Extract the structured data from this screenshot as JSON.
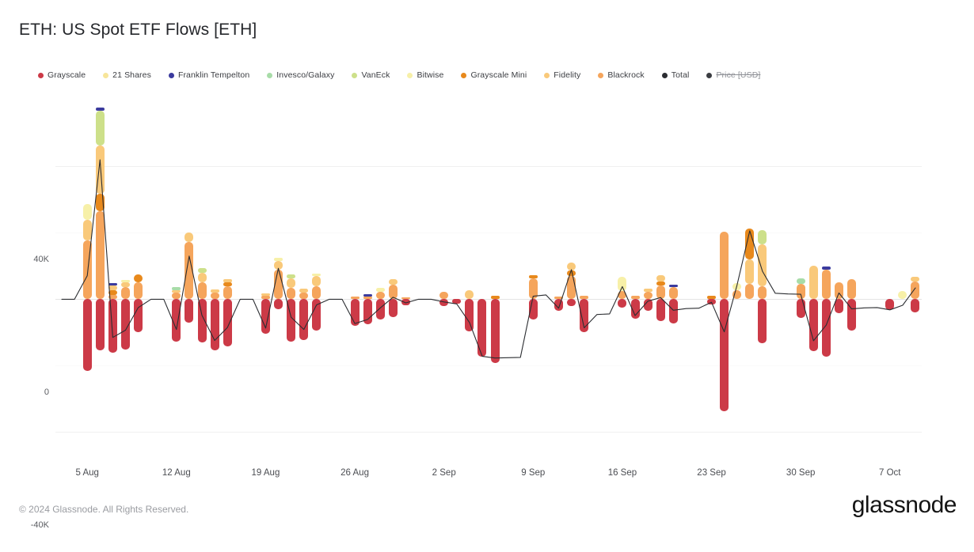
{
  "header": {
    "title": "ETH: US Spot ETF Flows [ETH]"
  },
  "footer": {
    "copyright": "© 2024 Glassnode. All Rights Reserved.",
    "brand": "glassnode"
  },
  "legend": {
    "items": [
      {
        "label": "Grayscale",
        "color": "#CC3A४7",
        "enabled": true
      },
      {
        "label": "21 Shares",
        "color": "#F7E59A",
        "enabled": true
      },
      {
        "label": "Franklin Tempelton",
        "color": "#3B3B9E",
        "enabled": true
      },
      {
        "label": "Invesco/Galaxy",
        "color": "#A8DCA8",
        "enabled": true
      },
      {
        "label": "VanEck",
        "color": "#CDE08A",
        "enabled": true
      },
      {
        "label": "Bitwise",
        "color": "#F7F0A8",
        "enabled": true
      },
      {
        "label": "Grayscale Mini",
        "color": "#E8891C",
        "enabled": true
      },
      {
        "label": "Fidelity",
        "color": "#F9C97A",
        "enabled": true
      },
      {
        "label": "Blackrock",
        "color": "#F5A55C",
        "enabled": true
      },
      {
        "label": "Total",
        "color": "#2B2D31",
        "enabled": true
      },
      {
        "label": "Price [USD]",
        "color": "#3B3D42",
        "enabled": false
      }
    ]
  },
  "chart_data": {
    "type": "bar",
    "title": "ETH: US Spot ETF Flows [ETH]",
    "subtype": "stacked-bar-with-line",
    "xlabel": "",
    "ylabel": "",
    "ylim": [
      -48000,
      62000
    ],
    "yticks": [
      40000,
      0,
      -40000
    ],
    "ytick_labels": [
      "40K",
      "0",
      "-40K"
    ],
    "xtick_labels": [
      "5 Aug",
      "12 Aug",
      "19 Aug",
      "26 Aug",
      "2 Sep",
      "9 Sep",
      "16 Sep",
      "23 Sep",
      "30 Sep",
      "7 Oct"
    ],
    "xtick_indices": [
      2,
      9,
      16,
      23,
      30,
      37,
      44,
      51,
      58,
      65
    ],
    "grid": true,
    "legend_position": "top-left",
    "series_order": [
      "Grayscale",
      "Blackrock",
      "Grayscale Mini",
      "Fidelity",
      "Bitwise",
      "21 Shares",
      "VanEck",
      "Invesco/Galaxy",
      "Franklin Tempelton"
    ],
    "series_colors": {
      "Grayscale": "#CC3A47",
      "Blackrock": "#F5A55C",
      "Grayscale Mini": "#E8891C",
      "Fidelity": "#F9C97A",
      "Bitwise": "#F7F0A8",
      "21 Shares": "#F7E59A",
      "VanEck": "#CDE08A",
      "Invesco/Galaxy": "#A8DCA8",
      "Franklin Tempelton": "#3B3B9E",
      "Total": "#2B2D31"
    },
    "note": "Each point: d=date label, pos=[[series,value]...] stacked upward from 0, neg=[[series,value]...] stacked downward from 0, total=black Total line value.",
    "points": [
      {
        "d": "3 Aug",
        "pos": [],
        "neg": [],
        "total": 0
      },
      {
        "d": "4 Aug",
        "pos": [],
        "neg": [],
        "total": 0
      },
      {
        "d": "5 Aug",
        "pos": [
          [
            "Blackrock",
            17800
          ],
          [
            "Fidelity",
            6200
          ],
          [
            "Bitwise",
            4600
          ]
        ],
        "neg": [
          [
            "Grayscale",
            -21500
          ]
        ],
        "total": 7100
      },
      {
        "d": "6 Aug",
        "pos": [
          [
            "Blackrock",
            26500
          ],
          [
            "Grayscale Mini",
            5200
          ],
          [
            "Fidelity",
            14500
          ],
          [
            "VanEck",
            10500
          ],
          [
            "Franklin Tempelton",
            900
          ]
        ],
        "neg": [
          [
            "Grayscale",
            -15500
          ]
        ],
        "total": 42000
      },
      {
        "d": "7 Aug",
        "pos": [
          [
            "Blackrock",
            1400
          ],
          [
            "Grayscale Mini",
            1300
          ],
          [
            "Fidelity",
            1500
          ],
          [
            "Franklin Tempelton",
            700
          ]
        ],
        "neg": [
          [
            "Grayscale",
            -16200
          ]
        ],
        "total": -11500
      },
      {
        "d": "8 Aug",
        "pos": [
          [
            "Blackrock",
            3600
          ],
          [
            "Fidelity",
            1400
          ],
          [
            "Bitwise",
            900
          ]
        ],
        "neg": [
          [
            "Grayscale",
            -15200
          ]
        ],
        "total": -9300
      },
      {
        "d": "9 Aug",
        "pos": [
          [
            "Blackrock",
            5000
          ],
          [
            "Grayscale Mini",
            2400
          ]
        ],
        "neg": [
          [
            "Grayscale",
            -9800
          ]
        ],
        "total": -2500
      },
      {
        "d": "10 Aug",
        "pos": [],
        "neg": [],
        "total": 0
      },
      {
        "d": "11 Aug",
        "pos": [],
        "neg": [],
        "total": 0
      },
      {
        "d": "12 Aug",
        "pos": [
          [
            "Blackrock",
            1900
          ],
          [
            "Fidelity",
            900
          ],
          [
            "Invesco/Galaxy",
            800
          ]
        ],
        "neg": [
          [
            "Grayscale",
            -12700
          ]
        ],
        "total": -9100
      },
      {
        "d": "13 Aug",
        "pos": [
          [
            "Blackrock",
            17200
          ],
          [
            "Fidelity",
            2900
          ]
        ],
        "neg": [
          [
            "Grayscale",
            -7100
          ]
        ],
        "total": 13000
      },
      {
        "d": "14 Aug",
        "pos": [
          [
            "Blackrock",
            5200
          ],
          [
            "Fidelity",
            2800
          ],
          [
            "VanEck",
            1400
          ]
        ],
        "neg": [
          [
            "Grayscale",
            -12900
          ]
        ],
        "total": -4800
      },
      {
        "d": "15 Aug",
        "pos": [
          [
            "Blackrock",
            2100
          ],
          [
            "Fidelity",
            900
          ]
        ],
        "neg": [
          [
            "Grayscale",
            -15300
          ]
        ],
        "total": -12400
      },
      {
        "d": "16 Aug",
        "pos": [
          [
            "Blackrock",
            3800
          ],
          [
            "Grayscale Mini",
            1300
          ],
          [
            "Fidelity",
            900
          ]
        ],
        "neg": [
          [
            "Grayscale",
            -14300
          ]
        ],
        "total": -8500
      },
      {
        "d": "17 Aug",
        "pos": [],
        "neg": [],
        "total": 0
      },
      {
        "d": "18 Aug",
        "pos": [],
        "neg": [],
        "total": 0
      },
      {
        "d": "19 Aug",
        "pos": [
          [
            "Blackrock",
            1100
          ],
          [
            "Fidelity",
            700
          ]
        ],
        "neg": [
          [
            "Grayscale",
            -10500
          ]
        ],
        "total": -8700
      },
      {
        "d": "20 Aug",
        "pos": [
          [
            "Blackrock",
            8900
          ],
          [
            "Fidelity",
            2600
          ],
          [
            "Bitwise",
            900
          ]
        ],
        "neg": [
          [
            "Grayscale",
            -3100
          ]
        ],
        "total": 9300
      },
      {
        "d": "21 Aug",
        "pos": [
          [
            "Blackrock",
            3400
          ],
          [
            "Fidelity",
            2900
          ],
          [
            "VanEck",
            1100
          ]
        ],
        "neg": [
          [
            "Grayscale",
            -12800
          ]
        ],
        "total": -5400
      },
      {
        "d": "22 Aug",
        "pos": [
          [
            "Blackrock",
            1900
          ],
          [
            "Fidelity",
            1200
          ]
        ],
        "neg": [
          [
            "Grayscale",
            -12200
          ]
        ],
        "total": -9100
      },
      {
        "d": "23 Aug",
        "pos": [
          [
            "Blackrock",
            3900
          ],
          [
            "Fidelity",
            3100
          ],
          [
            "Bitwise",
            700
          ]
        ],
        "neg": [
          [
            "Grayscale",
            -9400
          ]
        ],
        "total": -1700
      },
      {
        "d": "24 Aug",
        "pos": [],
        "neg": [],
        "total": 0
      },
      {
        "d": "25 Aug",
        "pos": [],
        "neg": [],
        "total": 0
      },
      {
        "d": "26 Aug",
        "pos": [
          [
            "Blackrock",
            800
          ]
        ],
        "neg": [
          [
            "Grayscale",
            -8100
          ]
        ],
        "total": -7300
      },
      {
        "d": "27 Aug",
        "pos": [
          [
            "Blackrock",
            900
          ],
          [
            "Franklin Tempelton",
            600
          ]
        ],
        "neg": [
          [
            "Grayscale",
            -7600
          ]
        ],
        "total": -6100
      },
      {
        "d": "28 Aug",
        "pos": [
          [
            "Blackrock",
            2200
          ],
          [
            "Bitwise",
            1300
          ]
        ],
        "neg": [
          [
            "Grayscale",
            -6100
          ]
        ],
        "total": -2600
      },
      {
        "d": "29 Aug",
        "pos": [
          [
            "Blackrock",
            4400
          ],
          [
            "Fidelity",
            1600
          ]
        ],
        "neg": [
          [
            "Grayscale",
            -5400
          ]
        ],
        "total": 600
      },
      {
        "d": "30 Aug",
        "pos": [
          [
            "Blackrock",
            600
          ]
        ],
        "neg": [
          [
            "Grayscale",
            -1700
          ]
        ],
        "total": -1100
      },
      {
        "d": "31 Aug",
        "pos": [],
        "neg": [],
        "total": 0
      },
      {
        "d": "1 Sep",
        "pos": [],
        "neg": [],
        "total": 0
      },
      {
        "d": "2 Sep",
        "pos": [
          [
            "Blackrock",
            2300
          ]
        ],
        "neg": [
          [
            "Grayscale",
            -2100
          ]
        ],
        "total": -800
      },
      {
        "d": "3 Sep",
        "pos": [],
        "neg": [
          [
            "Grayscale",
            -1400
          ]
        ],
        "total": -1400
      },
      {
        "d": "4 Sep",
        "pos": [
          [
            "Fidelity",
            2600
          ]
        ],
        "neg": [
          [
            "Grayscale",
            -9600
          ]
        ],
        "total": -7000
      },
      {
        "d": "5 Sep",
        "pos": [],
        "neg": [
          [
            "Grayscale",
            -17200
          ]
        ],
        "total": -17200
      },
      {
        "d": "6 Sep",
        "pos": [
          [
            "Grayscale Mini",
            1100
          ]
        ],
        "neg": [
          [
            "Grayscale",
            -19200
          ]
        ],
        "total": -17700
      },
      {
        "d": "7 Sep",
        "pos": [],
        "neg": [],
        "total": -17600
      },
      {
        "d": "8 Sep",
        "pos": [],
        "neg": [],
        "total": -17500
      },
      {
        "d": "9 Sep",
        "pos": [
          [
            "Blackrock",
            6400
          ],
          [
            "Grayscale Mini",
            900
          ]
        ],
        "neg": [
          [
            "Grayscale",
            -6100
          ]
        ],
        "total": 900
      },
      {
        "d": "10 Sep",
        "pos": [],
        "neg": [],
        "total": 1300
      },
      {
        "d": "11 Sep",
        "pos": [
          [
            "Blackrock",
            700
          ]
        ],
        "neg": [
          [
            "Grayscale",
            -3400
          ]
        ],
        "total": -2700
      },
      {
        "d": "12 Sep",
        "pos": [
          [
            "Blackrock",
            6900
          ],
          [
            "Grayscale Mini",
            1700
          ],
          [
            "Fidelity",
            2400
          ]
        ],
        "neg": [
          [
            "Grayscale",
            -2000
          ]
        ],
        "total": 8900
      },
      {
        "d": "13 Sep",
        "pos": [
          [
            "Blackrock",
            1100
          ]
        ],
        "neg": [
          [
            "Grayscale",
            -9900
          ]
        ],
        "total": -8600
      },
      {
        "d": "14 Sep",
        "pos": [],
        "neg": [],
        "total": -4600
      },
      {
        "d": "15 Sep",
        "pos": [],
        "neg": [],
        "total": -4400
      },
      {
        "d": "16 Sep",
        "pos": [
          [
            "Blackrock",
            2400
          ],
          [
            "Bitwise",
            4300
          ]
        ],
        "neg": [
          [
            "Grayscale",
            -2600
          ]
        ],
        "total": 3800
      },
      {
        "d": "17 Sep",
        "pos": [
          [
            "Blackrock",
            1100
          ]
        ],
        "neg": [
          [
            "Grayscale",
            -5900
          ]
        ],
        "total": -4900
      },
      {
        "d": "18 Sep",
        "pos": [
          [
            "Blackrock",
            2300
          ],
          [
            "Fidelity",
            900
          ]
        ],
        "neg": [
          [
            "Grayscale",
            -3400
          ]
        ],
        "total": -600
      },
      {
        "d": "19 Sep",
        "pos": [
          [
            "Blackrock",
            4100
          ],
          [
            "Grayscale Mini",
            1200
          ],
          [
            "Fidelity",
            1900
          ]
        ],
        "neg": [
          [
            "Grayscale",
            -6600
          ]
        ],
        "total": 500
      },
      {
        "d": "20 Sep",
        "pos": [
          [
            "Blackrock",
            3700
          ],
          [
            "Franklin Tempelton",
            700
          ]
        ],
        "neg": [
          [
            "Grayscale",
            -7400
          ]
        ],
        "total": -3300
      },
      {
        "d": "21 Sep",
        "pos": [],
        "neg": [],
        "total": -2800
      },
      {
        "d": "22 Sep",
        "pos": [],
        "neg": [],
        "total": -2700
      },
      {
        "d": "23 Sep",
        "pos": [
          [
            "Grayscale Mini",
            1100
          ]
        ],
        "neg": [
          [
            "Grayscale",
            -1600
          ]
        ],
        "total": -900
      },
      {
        "d": "24 Sep",
        "pos": [
          [
            "Blackrock",
            20400
          ]
        ],
        "neg": [
          [
            "Grayscale",
            -33800
          ]
        ],
        "total": -9800
      },
      {
        "d": "25 Sep",
        "pos": [
          [
            "Blackrock",
            2600
          ],
          [
            "Bitwise",
            2200
          ]
        ],
        "neg": [],
        "total": 4200
      },
      {
        "d": "26 Sep",
        "pos": [
          [
            "Blackrock",
            4600
          ],
          [
            "Fidelity",
            7500
          ],
          [
            "Grayscale Mini",
            9200
          ]
        ],
        "neg": [],
        "total": 20600
      },
      {
        "d": "27 Sep",
        "pos": [
          [
            "Blackrock",
            3900
          ],
          [
            "Fidelity",
            12600
          ],
          [
            "VanEck",
            4400
          ]
        ],
        "neg": [
          [
            "Grayscale",
            -13300
          ]
        ],
        "total": 8400
      },
      {
        "d": "28 Sep",
        "pos": [],
        "neg": [],
        "total": 1800
      },
      {
        "d": "29 Sep",
        "pos": [],
        "neg": [],
        "total": 1600
      },
      {
        "d": "30 Sep",
        "pos": [
          [
            "Blackrock",
            4700
          ],
          [
            "Invesco/Galaxy",
            1600
          ]
        ],
        "neg": [
          [
            "Grayscale",
            -5600
          ]
        ],
        "total": 1500
      },
      {
        "d": "1 Oct",
        "pos": [
          [
            "Fidelity",
            10100
          ]
        ],
        "neg": [
          [
            "Grayscale",
            -15600
          ]
        ],
        "total": -12500
      },
      {
        "d": "2 Oct",
        "pos": [
          [
            "Blackrock",
            8900
          ],
          [
            "Franklin Tempelton",
            900
          ]
        ],
        "neg": [
          [
            "Grayscale",
            -17300
          ]
        ],
        "total": -7800
      },
      {
        "d": "3 Oct",
        "pos": [
          [
            "Blackrock",
            5200
          ]
        ],
        "neg": [
          [
            "Grayscale",
            -4300
          ]
        ],
        "total": 1900
      },
      {
        "d": "4 Oct",
        "pos": [
          [
            "Blackrock",
            6100
          ]
        ],
        "neg": [
          [
            "Grayscale",
            -9400
          ]
        ],
        "total": -2900
      },
      {
        "d": "5 Oct",
        "pos": [],
        "neg": [],
        "total": -2600
      },
      {
        "d": "6 Oct",
        "pos": [],
        "neg": [],
        "total": -2500
      },
      {
        "d": "7 Oct",
        "pos": [],
        "neg": [
          [
            "Grayscale",
            -3200
          ]
        ],
        "total": -3200
      },
      {
        "d": "8 Oct",
        "pos": [
          [
            "Bitwise",
            2400
          ]
        ],
        "neg": [],
        "total": -1800
      },
      {
        "d": "9 Oct",
        "pos": [
          [
            "Blackrock",
            5300
          ],
          [
            "Fidelity",
            1500
          ]
        ],
        "neg": [
          [
            "Grayscale",
            -3900
          ]
        ],
        "total": 3400
      }
    ]
  }
}
